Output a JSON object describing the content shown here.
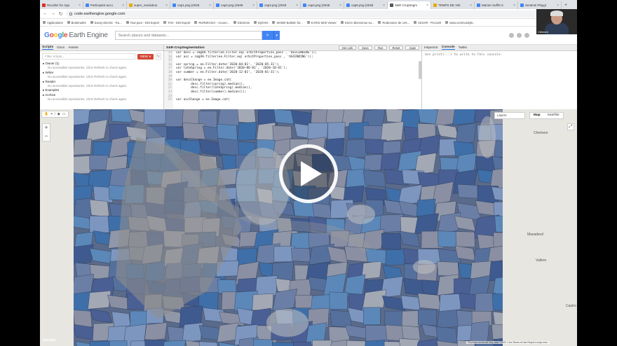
{
  "browser": {
    "tabs": [
      {
        "label": "Recoller for App",
        "fav": "r"
      },
      {
        "label": "Participant acco",
        "fav": "b"
      },
      {
        "label": "super_resolution",
        "fav": "g"
      },
      {
        "label": "cap1.png (2048",
        "fav": "b"
      },
      {
        "label": "cap2.png (2048",
        "fav": "b"
      },
      {
        "label": "cap3.png (2048",
        "fav": "b"
      },
      {
        "label": "cap4.png (2048",
        "fav": "b"
      },
      {
        "label": "cap5.png (2048",
        "fav": "b"
      },
      {
        "label": "S&R CropSegm",
        "fav": "k"
      },
      {
        "label": "TEMPS DE VIE",
        "fav": "g"
      },
      {
        "label": "Marine Suffrit S",
        "fav": "b"
      },
      {
        "label": "Sentinel Playgr",
        "fav": "b"
      }
    ],
    "active_tab_index": 8,
    "url": "code.earthengine.google.com",
    "bookmarks": [
      "Applications",
      "Bookmarks",
      "Savoy Electric - Ru...",
      "Tout pour - EDI Export",
      "TAO - EDI Export",
      "RURWICKU! - Accuei...",
      "Elections",
      "Dyferris",
      "WAMD Bulletin for...",
      "KARIS Web Viewer",
      "ESAC Bienvenue su...",
      "Redevance de cert...",
      "CESAR - PLCash",
      "www.communityB..."
    ]
  },
  "gee": {
    "logo": {
      "google": "Google",
      "product": "Earth Engine"
    },
    "search_placeholder": "Search places and datasets..."
  },
  "left_panel": {
    "tabs": [
      "Scripts",
      "Docs",
      "Assets"
    ],
    "filter_placeholder": "Filter scripts...",
    "new_label": "NEW",
    "tree": [
      {
        "label": "Owner (1)",
        "msg": "No accessible repositories. Click Refresh to check again."
      },
      {
        "label": "Writer",
        "msg": "No accessible repositories. Click Refresh to check again."
      },
      {
        "label": "Reader",
        "msg": "No accessible repositories. Click Refresh to check again."
      },
      {
        "label": "Examples",
        "msg": ""
      },
      {
        "label": "Archive",
        "msg": "No accessible repositories. Click Refresh to check again."
      }
    ]
  },
  "editor": {
    "title": "S&R-CropSegmentation",
    "buttons": [
      "Get Link",
      "Save",
      "Run",
      "Reset",
      "Apps"
    ],
    "line_numbers": [
      "13",
      "14",
      "15",
      "16",
      "17",
      "18",
      "19",
      "20",
      "21",
      "22",
      "23",
      "24",
      "25"
    ],
    "code_lines": [
      "var desc = imgVH.filter(ee.Filter.eq( orbitProperties_pass , 'DESCENDING'));",
      "var asc = imgVH.filter(ee.Filter.eq( orbitProperties_pass , 'ASCENDING'));",
      "",
      "var spring = ee.Filter.date('2020-04-01', '2020-05-31');",
      "var lateSpring = ee.Filter.date('2020-06-01', '2020-10-01');",
      "var summer = ee.Filter.date('2020-12-01', '2020-01-31');",
      "",
      "var descChange = ee.Image.cat(",
      "        desc.filter(spring).median(),",
      "        desc.filter(lateSpring).median(),",
      "        desc.filter(summer).median());",
      "",
      "var ascChange = ee.Image.cat("
    ]
  },
  "right_panel": {
    "tabs": [
      "Inspector",
      "Console",
      "Tasks"
    ],
    "active": "Console",
    "console_text": "Use print(...) to write to this console."
  },
  "map": {
    "tools": [
      "✋",
      "⌖",
      "∕",
      "◆",
      "▭"
    ],
    "layers_label": "Layers",
    "map_types": [
      "Map",
      "Satellite"
    ],
    "place_labels": [
      "Chemere",
      "Maxadeuil",
      "Vallere",
      "Castro"
    ],
    "google_logo": "Google",
    "attribution": "Keyboard shortcuts  Map data ©2021  1 km  Terms of Use  Report a map error"
  },
  "webcam": {
    "name": "Clément"
  }
}
